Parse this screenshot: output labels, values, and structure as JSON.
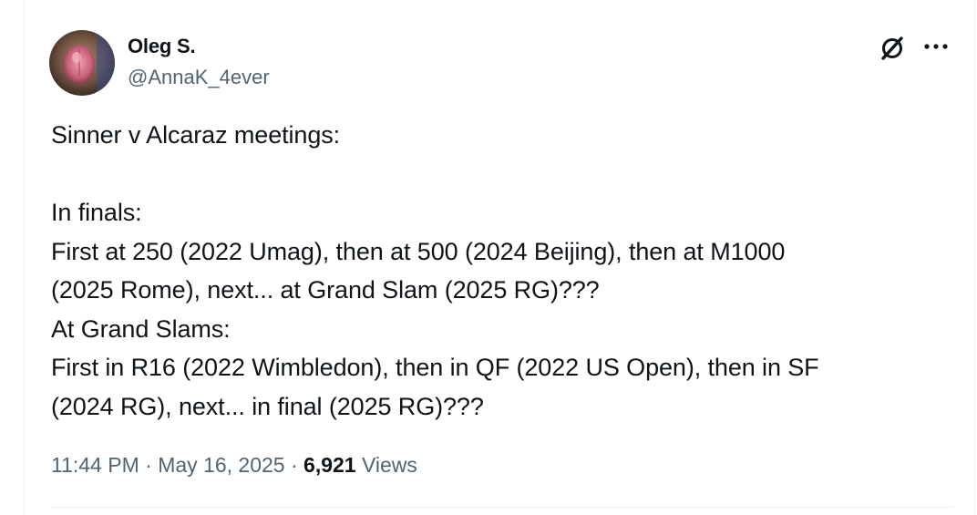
{
  "author": {
    "display_name": "Oleg S.",
    "handle": "@AnnaK_4ever",
    "avatar_icon": "profile-photo"
  },
  "actions": {
    "grok_icon": "grok-icon",
    "more_icon": "more-horizontal-icon"
  },
  "tweet": {
    "lines": [
      "Sinner v Alcaraz meetings:",
      "",
      "In finals:",
      "First at 250 (2022 Umag), then at 500 (2024 Beijing), then at M1000",
      "(2025 Rome), next... at Grand Slam (2025 RG)???",
      "At Grand Slams:",
      "First in R16 (2022 Wimbledon), then in QF (2022 US Open), then in SF",
      "(2024 RG), next... in final (2025 RG)???"
    ]
  },
  "meta": {
    "time": "11:44 PM",
    "separator": "·",
    "date": "May 16, 2025",
    "views_count": "6,921",
    "views_label": "Views"
  },
  "colors": {
    "text": "#0f1419",
    "secondary": "#536471",
    "divider": "#eff3f4"
  }
}
